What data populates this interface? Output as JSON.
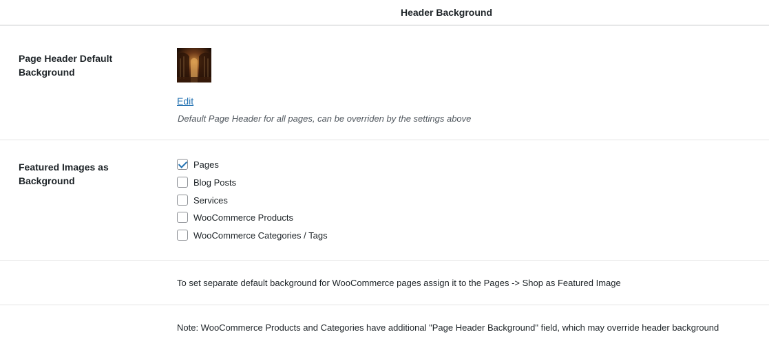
{
  "header": {
    "title": "Header Background"
  },
  "default_background": {
    "label": "Page Header Default Background",
    "edit_label": "Edit",
    "description": "Default Page Header for all pages, can be overriden by the settings above"
  },
  "featured_images": {
    "label": "Featured Images as Background",
    "options": [
      {
        "label": "Pages",
        "checked": true
      },
      {
        "label": "Blog Posts",
        "checked": false
      },
      {
        "label": "Services",
        "checked": false
      },
      {
        "label": "WooCommerce Products",
        "checked": false
      },
      {
        "label": "WooCommerce Categories / Tags",
        "checked": false
      }
    ]
  },
  "notes": {
    "shop_note": "To set separate default background for WooCommerce pages assign it to the Pages -> Shop as Featured Image",
    "products_note": "Note: WooCommerce Products and Categories have additional \"Page Header Background\" field, which may override header background"
  },
  "colors": {
    "accent": "#2271b1",
    "text": "#1d2327",
    "divider": "#e5e5e5"
  }
}
